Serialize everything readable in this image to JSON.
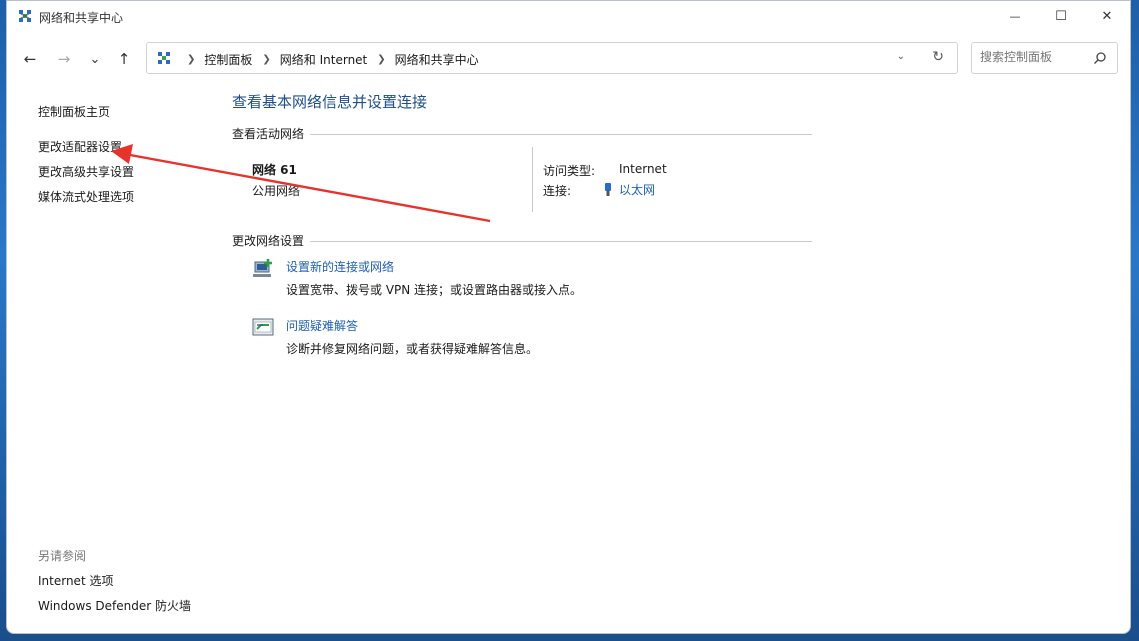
{
  "window": {
    "title": "网络和共享中心"
  },
  "titlebar_buttons": {
    "minimize": "—",
    "maximize": "☐",
    "close": "✕"
  },
  "nav": {
    "back": "←",
    "forward": "→",
    "recent": "⌄",
    "up": "↑",
    "breadcrumbs": [
      "控制面板",
      "网络和 Internet",
      "网络和共享中心"
    ],
    "search_placeholder": "搜索控制面板"
  },
  "sidebar": {
    "links": [
      "控制面板主页",
      "更改适配器设置",
      "更改高级共享设置",
      "媒体流式处理选项"
    ],
    "see_also_heading": "另请参阅",
    "see_also_links": [
      "Internet 选项",
      "Windows Defender 防火墙"
    ]
  },
  "main": {
    "title": "查看基本网络信息并设置连接",
    "active_networks_label": "查看活动网络",
    "network": {
      "name": "网络 61",
      "category": "公用网络",
      "access_type_label": "访问类型:",
      "access_type_value": "Internet",
      "connections_label": "连接:",
      "connections_value": "以太网"
    },
    "change_settings_label": "更改网络设置",
    "tasks": [
      {
        "link": "设置新的连接或网络",
        "desc": "设置宽带、拨号或 VPN 连接；或设置路由器或接入点。"
      },
      {
        "link": "问题疑难解答",
        "desc": "诊断并修复网络问题，或者获得疑难解答信息。"
      }
    ]
  },
  "colors": {
    "link": "#1e5fb4",
    "title": "#1e4e8c",
    "annotation_arrow": "#e8322c"
  }
}
